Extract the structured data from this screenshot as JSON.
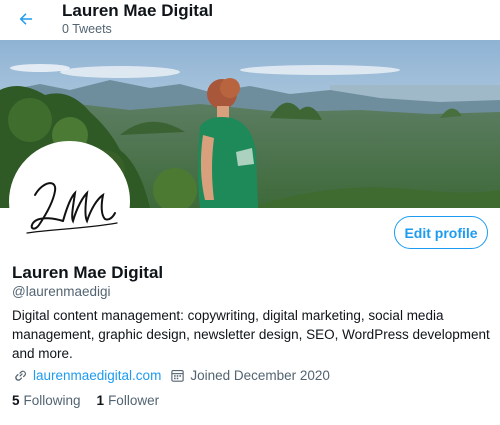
{
  "header": {
    "title": "Lauren Mae Digital",
    "tweet_count": "0 Tweets"
  },
  "profile": {
    "display_name": "Lauren Mae Digital",
    "handle": "@laurenmaedigi",
    "bio": "Digital content management: copywriting, digital marketing, social media management, graphic design, newsletter design, SEO, WordPress development and more.",
    "website": "laurenmaedigital.com",
    "joined": "Joined December 2020",
    "edit_button": "Edit profile",
    "following_count": "5",
    "following_label": "Following",
    "followers_count": "1",
    "followers_label": "Follower"
  },
  "icons": {
    "back": "arrow-left-icon",
    "website": "link-icon",
    "joined": "calendar-icon"
  },
  "colors": {
    "accent": "#1d9bf0",
    "secondary_text": "#536471",
    "primary_text": "#0f1419"
  }
}
